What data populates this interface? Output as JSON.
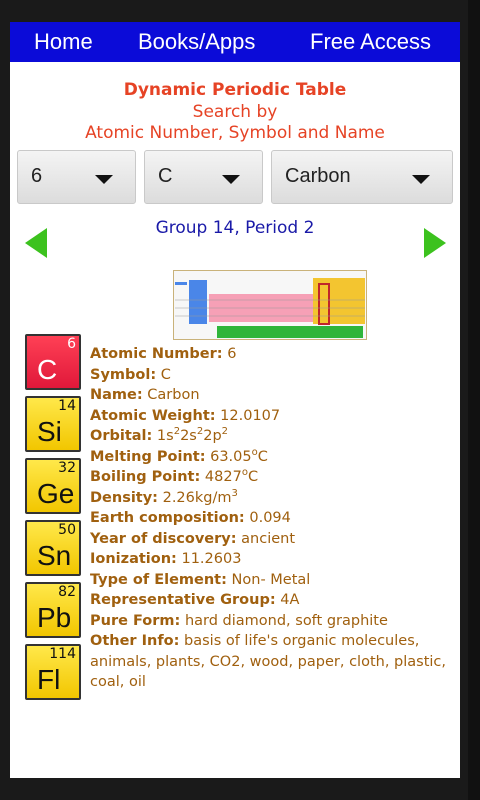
{
  "nav": {
    "home": "Home",
    "books_apps": "Books/Apps",
    "free_access": "Free Access"
  },
  "header": {
    "title": "Dynamic Periodic Table",
    "subtitle_line1": "Search by",
    "subtitle_line2": "Atomic Number, Symbol and Name"
  },
  "search": {
    "atomic_number": "6",
    "symbol": "C",
    "name": "Carbon"
  },
  "group_period": "Group 14, Period 2",
  "tiles": [
    {
      "symbol": "C",
      "number": "6",
      "color": "red"
    },
    {
      "symbol": "Si",
      "number": "14",
      "color": "yellow"
    },
    {
      "symbol": "Ge",
      "number": "32",
      "color": "yellow"
    },
    {
      "symbol": "Sn",
      "number": "50",
      "color": "yellow"
    },
    {
      "symbol": "Pb",
      "number": "82",
      "color": "yellow"
    },
    {
      "symbol": "Fl",
      "number": "114",
      "color": "yellow"
    }
  ],
  "details": {
    "atomic_number_label": "Atomic Number:",
    "atomic_number_value": "6",
    "symbol_label": "Symbol:",
    "symbol_value": "C",
    "name_label": "Name:",
    "name_value": "Carbon",
    "atomic_weight_label": "Atomic Weight:",
    "atomic_weight_value": "12.0107",
    "orbital_label": "Orbital:",
    "orbital_1": "1s",
    "orbital_1_sup": "2",
    "orbital_2": "2s",
    "orbital_2_sup": "2",
    "orbital_3": "2p",
    "orbital_3_sup": "2",
    "melting_label": "Melting Point:",
    "melting_value": "63.05",
    "melting_sup": "o",
    "melting_unit": "C",
    "boiling_label": "Boiling Point:",
    "boiling_value": "4827",
    "boiling_sup": "o",
    "boiling_unit": "C",
    "density_label": "Density:",
    "density_value": "2.26kg/m",
    "density_sup": "3",
    "earth_label": "Earth composition:",
    "earth_value": "0.094",
    "discovery_label": "Year of discovery:",
    "discovery_value": "ancient",
    "ionization_label": "Ionization:",
    "ionization_value": "11.2603",
    "type_label": "Type of Element:",
    "type_value": "Non- Metal",
    "rep_group_label": "Representative Group:",
    "rep_group_value": "4A",
    "pure_form_label": "Pure Form:",
    "pure_form_value": "hard diamond, soft graphite",
    "other_label": "Other Info:",
    "other_value": "basis of life's organic molecules, animals, plants, CO2, wood, paper, cloth, plastic, coal, oil"
  },
  "colors": {
    "nav_bg": "#0b0bd8",
    "title": "#e64325",
    "group_label": "#1a1aa8",
    "details_text": "#a0600f",
    "arrow_green": "#3cc21e"
  }
}
